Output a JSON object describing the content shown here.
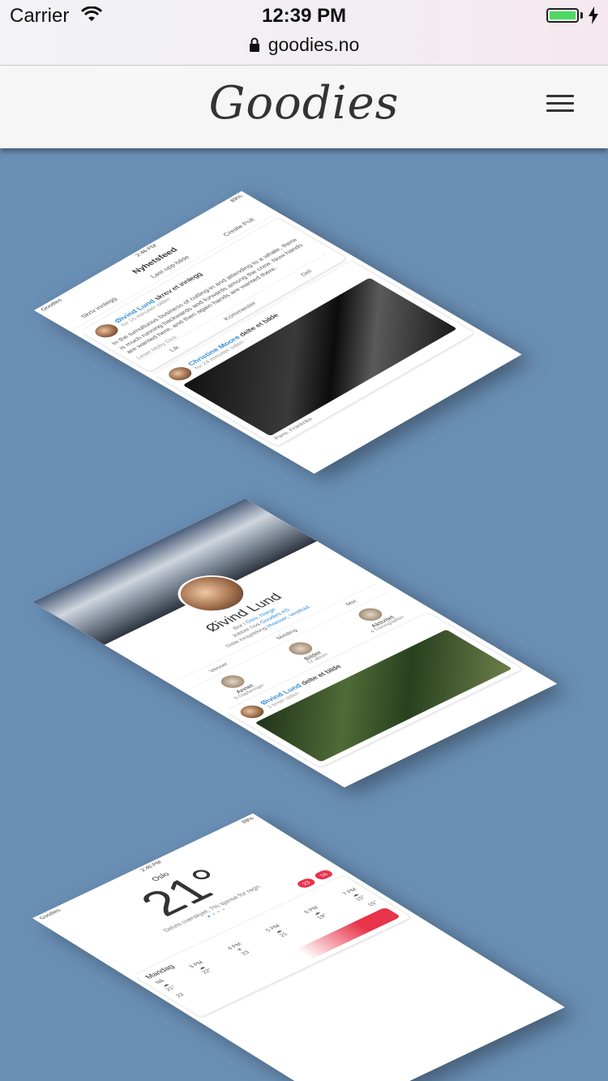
{
  "status_bar": {
    "carrier": "Carrier",
    "time": "12:39 PM"
  },
  "browser": {
    "url": "goodies.no"
  },
  "site": {
    "logo": "Goodies"
  },
  "feed_phone": {
    "status_left": "Goodies",
    "status_time": "2:46 PM",
    "status_right": "89%",
    "title": "Nyhetsfeed",
    "tabs": [
      "Skriv innlegg",
      "Last opp bilde",
      "Create Poll"
    ],
    "post1": {
      "author": "Øivind Lund",
      "action": "skrev et innlegg",
      "time": "for 15 minutter siden",
      "text": "In the tumultuous business of cutting-in and attending to a whale, there is much running backwards and forwards among the crew. Now hands are wanted here, and then again hands are wanted there.",
      "source": "Leser Moby Dick",
      "actions": [
        "Lik",
        "Kommenter",
        "Del"
      ]
    },
    "post2": {
      "author": "Christine Moore",
      "action": "delte et bilde",
      "time": "for 24 minutter siden",
      "location": "Paris, Frankrike"
    }
  },
  "profile_phone": {
    "name": "Øivind Lund",
    "info": [
      "Bor i",
      "Oslo, Norge",
      "Jobber hos",
      "Goodies AS",
      "Siste innsjekking",
      "Hvasser, Vestfold"
    ],
    "actions": [
      "Venner",
      "Melding",
      "Mer"
    ],
    "grid": [
      {
        "label": "Annet",
        "sub": "6 Oppføringer"
      },
      {
        "label": "Bilder",
        "sub": "12 album"
      },
      {
        "label": "Aktivitet",
        "sub": "4 Treningsøkter"
      }
    ],
    "post": {
      "author": "Øivind Lund",
      "action": "delte et bilde",
      "time": "3 timer siden"
    }
  },
  "weather_phone": {
    "status_left": "Goodies",
    "status_time": "2:46 PM",
    "status_right": "89%",
    "city": "Oslo",
    "temp": "21°",
    "condition": "Delvis overskyet, 7% sjanse for regn",
    "badges": [
      "23",
      "16"
    ],
    "day": "Mandag",
    "hours": [
      {
        "label": "Nå",
        "temp": "21°"
      },
      {
        "label": "3 PM",
        "temp": "22°"
      },
      {
        "label": "4 PM",
        "temp": "23"
      },
      {
        "label": "5 PM",
        "temp": "21"
      },
      {
        "label": "6 PM",
        "temp": "19°"
      },
      {
        "label": "7 PM",
        "temp": "15°"
      }
    ],
    "bottom_values": [
      "23",
      "15°"
    ]
  },
  "colors": {
    "page_bg": "#6a8fb5",
    "link": "#2e8bd8",
    "accent_red": "#e8334a",
    "battery": "#4cd964"
  }
}
